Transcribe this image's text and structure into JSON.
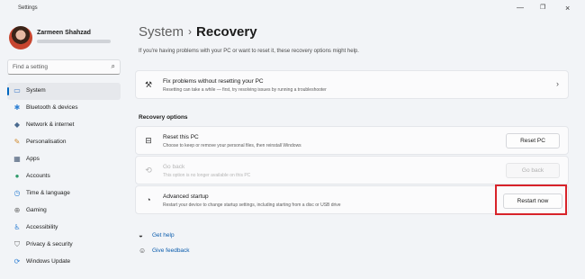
{
  "window": {
    "app_title": "Settings",
    "min_icon": "—",
    "max_icon": "❐",
    "close_icon": "×"
  },
  "user": {
    "name": "Zarmeen Shahzad"
  },
  "search": {
    "placeholder": "Find a setting",
    "icon": "⌕"
  },
  "sidebar": {
    "items": [
      {
        "label": "System",
        "icon": "▭",
        "icon_name": "system-icon",
        "color": "#3a78c9",
        "active": true
      },
      {
        "label": "Bluetooth & devices",
        "icon": "✱",
        "icon_name": "bluetooth-icon",
        "color": "#2d7fd3"
      },
      {
        "label": "Network & internet",
        "icon": "◆",
        "icon_name": "network-icon",
        "color": "#4a6a8f"
      },
      {
        "label": "Personalisation",
        "icon": "✎",
        "icon_name": "brush-icon",
        "color": "#d08a2c"
      },
      {
        "label": "Apps",
        "icon": "▦",
        "icon_name": "apps-icon",
        "color": "#4a5d78"
      },
      {
        "label": "Accounts",
        "icon": "●",
        "icon_name": "accounts-icon",
        "color": "#2e9a6a"
      },
      {
        "label": "Time & language",
        "icon": "◷",
        "icon_name": "clock-icon",
        "color": "#2d7fd3"
      },
      {
        "label": "Gaming",
        "icon": "⊕",
        "icon_name": "gaming-icon",
        "color": "#6a6a6a"
      },
      {
        "label": "Accessibility",
        "icon": "♿",
        "icon_name": "accessibility-icon",
        "color": "#2d7fd3"
      },
      {
        "label": "Privacy & security",
        "icon": "⛉",
        "icon_name": "shield-icon",
        "color": "#6a6a6a"
      },
      {
        "label": "Windows Update",
        "icon": "⟳",
        "icon_name": "update-icon",
        "color": "#2d7fd3"
      }
    ]
  },
  "main": {
    "breadcrumb_parent": "System",
    "breadcrumb_sep": "›",
    "breadcrumb_current": "Recovery",
    "description": "If you're having problems with your PC or want to reset it, these recovery options might help.",
    "fix_card": {
      "icon": "⚒",
      "title": "Fix problems without resetting your PC",
      "desc": "Resetting can take a while — first, try resolving issues by running a troubleshooter",
      "chevron": "›"
    },
    "section_label": "Recovery options",
    "options": [
      {
        "icon": "⊟",
        "icon_name": "reset-pc-icon",
        "title": "Reset this PC",
        "desc": "Choose to keep or remove your personal files, then reinstall Windows",
        "button": "Reset PC",
        "disabled": false
      },
      {
        "icon": "⟲",
        "icon_name": "go-back-icon",
        "title": "Go back",
        "desc": "This option is no longer available on this PC",
        "button": "Go back",
        "disabled": true
      },
      {
        "icon": "◔",
        "icon_name": "advanced-startup-icon",
        "title": "Advanced startup",
        "desc": "Restart your device to change startup settings, including starting from a disc or USB drive",
        "button": "Restart now",
        "disabled": false,
        "highlighted": true
      }
    ],
    "links": [
      {
        "icon": "◒",
        "icon_name": "help-icon",
        "label": "Get help"
      },
      {
        "icon": "☺",
        "icon_name": "feedback-icon",
        "label": "Give feedback"
      }
    ]
  },
  "colors": {
    "accent": "#0067c0",
    "highlight_border": "#d8232a",
    "link": "#0b5cad",
    "background": "#f2f4f7"
  }
}
